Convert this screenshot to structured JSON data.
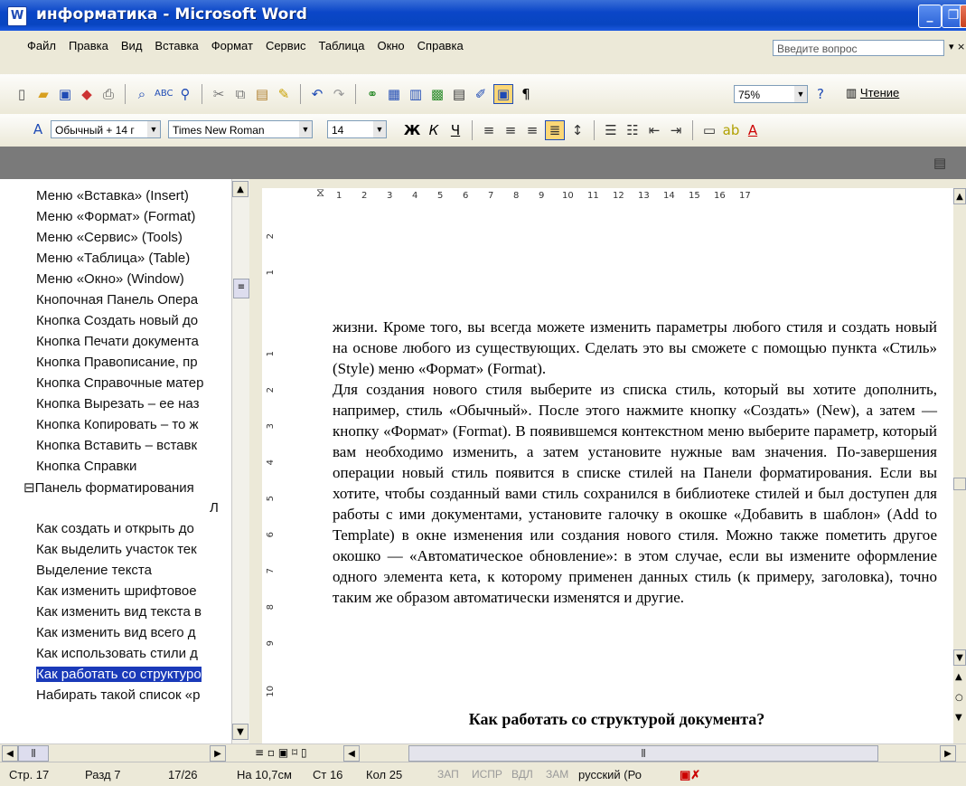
{
  "window": {
    "title": "информатика - Microsoft Word",
    "icon": "W"
  },
  "menu": {
    "items": [
      "Файл",
      "Правка",
      "Вид",
      "Вставка",
      "Формат",
      "Сервис",
      "Таблица",
      "Окно",
      "Справка"
    ],
    "ask_placeholder": "Введите вопрос"
  },
  "toolbar": {
    "zoom": "75%",
    "reading": "Чтение"
  },
  "format": {
    "style": "Обычный + 14 г",
    "font": "Times New Roman",
    "size": "14"
  },
  "docmap": {
    "items": [
      {
        "label": "Меню «Вставка» (Insert)"
      },
      {
        "label": "Меню «Формат» (Format)"
      },
      {
        "label": "Меню «Сервис» (Tools)"
      },
      {
        "label": "Меню «Таблица» (Table)"
      },
      {
        "label": "Меню «Окно» (Window)"
      },
      {
        "label": "Кнопочная Панель Опера"
      },
      {
        "label": "Кнопка Создать новый до"
      },
      {
        "label": "Кнопка Печати документа"
      },
      {
        "label": "Кнопка Правописание, пр"
      },
      {
        "label": "Кнопка Справочные матер"
      },
      {
        "label": "Кнопка Вырезать – ее наз"
      },
      {
        "label": "Кнопка Копировать – то ж"
      },
      {
        "label": "Кнопка Вставить – вставк"
      },
      {
        "label": "Кнопка Справки"
      },
      {
        "label": "⊟Панель форматирования"
      },
      {
        "label": "Л"
      },
      {
        "label": "Как создать и открыть до"
      },
      {
        "label": "Как выделить участок тек"
      },
      {
        "label": "Выделение текста"
      },
      {
        "label": "Как изменить шрифтовое"
      },
      {
        "label": "Как изменить вид текста в"
      },
      {
        "label": "Как изменить вид всего д"
      },
      {
        "label": "Как использовать стили д"
      },
      {
        "label": "Как работать со структуро"
      },
      {
        "label": "Набирать такой список «р"
      }
    ]
  },
  "document": {
    "paragraph1": "жизни. Кроме того, вы всегда можете изменить параметры любого стиля и создать новый на основе любого из существующих. Сделать это вы сможете с помощью пункта «Стиль» (Style) меню «Формат» (Format).",
    "paragraph2": "Для создания нового стиля выберите из списка стиль, который вы хотите дополнить, например, стиль «Обычный». После этого нажмите кнопку «Создать» (New), а затем — кнопку «Формат» (Format). В появившемся контекстном меню выберите параметр, который вам необходимо изменить, а затем установите нужные вам значения. По-завершения операции новый стиль появится в списке стилей на Панели форматирования. Если вы хотите, чтобы созданный вами стиль сохранился в библиотеке стилей и был доступен для работы с ими документами, установите галочку в окошке «Добавить в шаблон» (Add to Template) в окне изменения или создания нового стиля. Можно также пометить другое окошко — «Автоматическое обновление»: в этом случае, если вы измените оформление одного элемента кета, к которому применен данных стиль (к примеру, заголовка), точно таким же образом автоматически изменятся и другие.",
    "heading": "Как работать со структурой документа?"
  },
  "status": {
    "page": "Стр. 17",
    "section": "Разд 7",
    "pages": "17/26",
    "at": "На 10,7см",
    "line": "Ст 16",
    "col": "Кол 25",
    "rec": "ЗАП",
    "trk": "ИСПР",
    "ext": "ВДЛ",
    "ovr": "ЗАМ",
    "lang": "русский (Ро"
  }
}
